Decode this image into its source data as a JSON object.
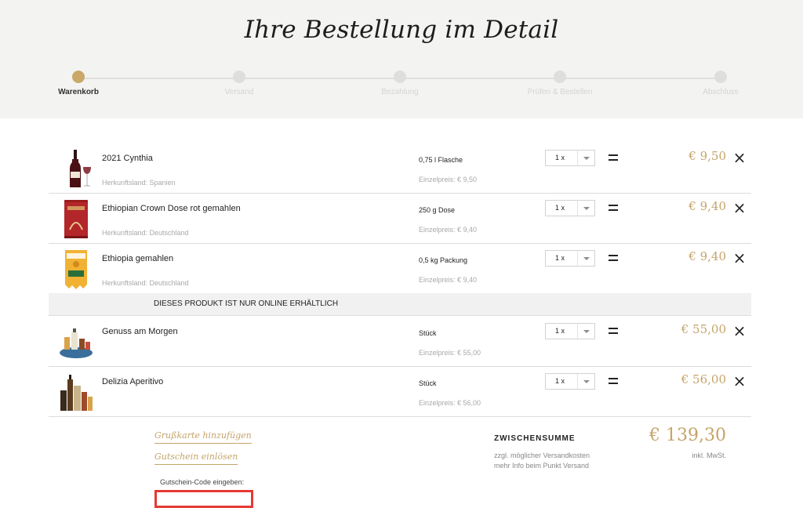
{
  "header": {
    "title": "Ihre Bestellung im Detail",
    "steps": [
      {
        "label": "Warenkorb"
      },
      {
        "label": "Versand"
      },
      {
        "label": "Bezahlung"
      },
      {
        "label": "Prüfen & Bestellen"
      },
      {
        "label": "Abschluss"
      }
    ]
  },
  "cart": {
    "items": [
      {
        "name": "2021 Cynthia",
        "origin": "Herkunftsland: Spanien",
        "size": "0,75 l Flasche",
        "unit_price": "Einzelpreis: € 9,50",
        "qty": "1 x",
        "price": "€ 9,50"
      },
      {
        "name": "Ethiopian Crown Dose rot gemahlen",
        "origin": "Herkunftsland: Deutschland",
        "size": "250 g Dose",
        "unit_price": "Einzelpreis: € 9,40",
        "qty": "1 x",
        "price": "€ 9,40"
      },
      {
        "name": "Ethiopia gemahlen",
        "origin": "Herkunftsland: Deutschland",
        "size": "0,5 kg Packung",
        "unit_price": "Einzelpreis: € 9,40",
        "qty": "1 x",
        "price": "€ 9,40"
      },
      {
        "name": "Genuss am Morgen",
        "origin": "",
        "size": "Stück",
        "unit_price": "Einzelpreis: € 55,00",
        "qty": "1 x",
        "price": "€ 55,00"
      },
      {
        "name": "Delizia Aperitivo",
        "origin": "",
        "size": "Stück",
        "unit_price": "Einzelpreis: € 56,00",
        "qty": "1 x",
        "price": "€ 56,00"
      }
    ],
    "online_notice": "DIESES PRODUKT IST NUR ONLINE ERHÄLTLICH"
  },
  "footer": {
    "greeting_card_link": "Grußkarte hinzufügen",
    "voucher_link": "Gutschein einlösen",
    "coupon_label": "Gutschein-Code eingeben:",
    "coupon_value": "",
    "subtotal_label": "ZWISCHENSUMME",
    "subtotal_note_1": "zzgl. möglicher Versandkosten",
    "subtotal_note_2": "mehr Info beim Punkt Versand",
    "subtotal_value": "€ 139,30",
    "vat_note": "inkl. MwSt."
  },
  "colors": {
    "accent": "#c5a46a",
    "highlight": "#e53935",
    "header_bg": "#f3f3f2"
  },
  "icons": [
    "close-icon",
    "chevron-down-icon",
    "equals-icon"
  ]
}
